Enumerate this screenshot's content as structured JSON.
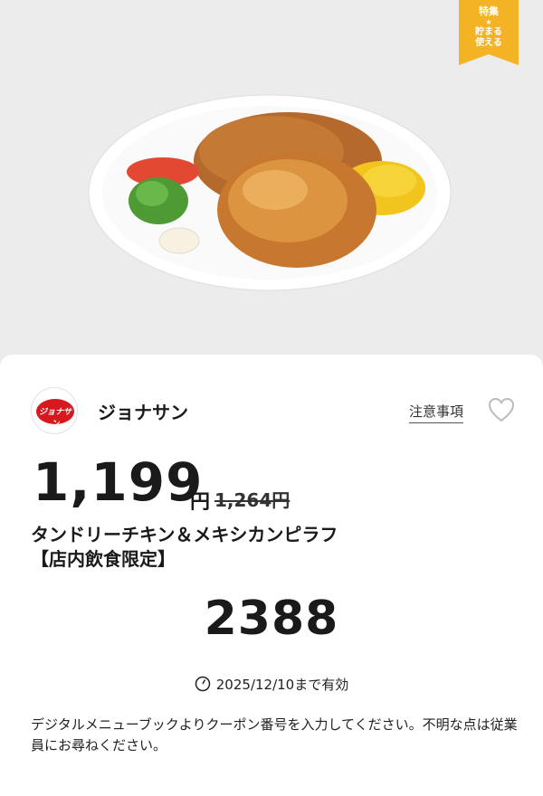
{
  "ribbon": {
    "line1": "特集",
    "line2": "★",
    "line3": "貯まる",
    "line4": "使える"
  },
  "store": {
    "logo_text": "ジョナサン",
    "name": "ジョナサン"
  },
  "actions": {
    "notice": "注意事項",
    "favorite_icon": "heart-outline-icon"
  },
  "offer": {
    "price": "1,199",
    "currency": "円",
    "original_price": "1,264円",
    "title": "タンドリーチキン＆メキシカンピラフ",
    "subtitle": "【店内飲食限定】",
    "coupon_code": "2388",
    "validity": "2025/12/10まで有効",
    "instructions": "デジタルメニューブックよりクーポン番号を入力してください。不明な点は従業員にお尋ねください。"
  },
  "colors": {
    "ribbon": "#f3b325",
    "brand_red": "#d7191f",
    "background": "#ececec"
  }
}
